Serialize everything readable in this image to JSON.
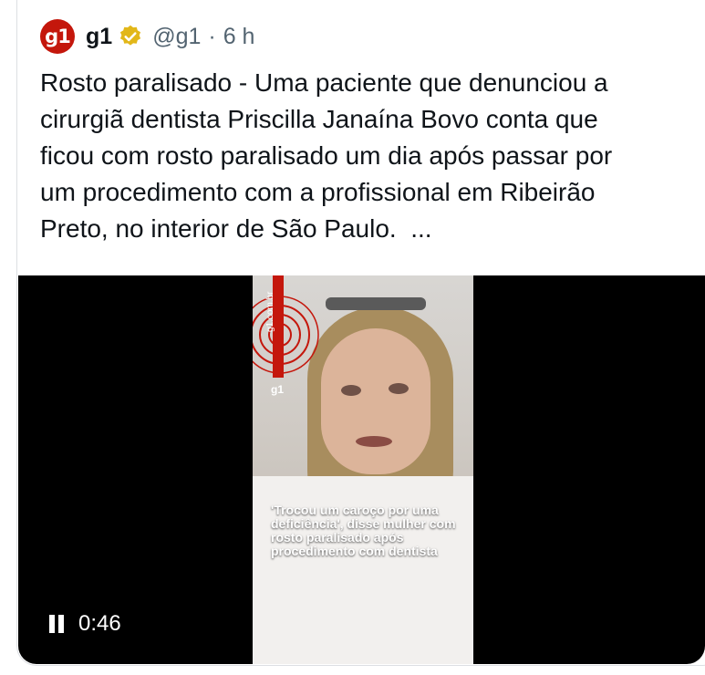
{
  "account": {
    "avatar_text": "g1",
    "name": "g1",
    "handle": "@g1",
    "separator": "·",
    "time": "6 h",
    "verified_color": "#e2b719",
    "brand_color": "#c4170c"
  },
  "tweet": {
    "text": "Rosto paralisado - Uma paciente que denunciou a\ncirurgiã dentista Priscilla Janaína Bovo conta que\nficou com rosto paralisado um dia após passar por\num procedimento com a profissional em Ribeirão\nPreto, no interior de São Paulo.  ..."
  },
  "video": {
    "watermark_url": "g1.com.br",
    "watermark_logo": "g1",
    "caption": "'Trocou um caroço por uma deficiência', disse mulher com rosto paralisado após procedimento com dentista",
    "time": "0:46",
    "control_icon": "pause-icon"
  }
}
